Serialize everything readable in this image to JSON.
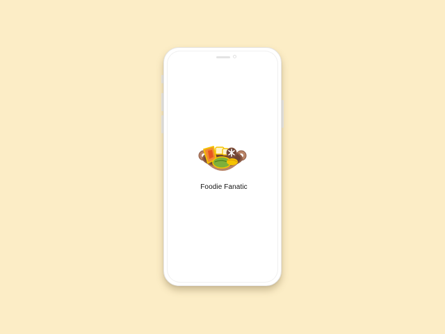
{
  "app": {
    "name": "Foodie Fanatic",
    "logo_icon": "hot-pot-icon"
  },
  "colors": {
    "background": "#fcedc6",
    "phone_body": "#ffffff",
    "pot": "#b98467",
    "pot_rim": "#8c5a44",
    "broth": "#6e4434",
    "carrot": "#f08b32",
    "carrot_outline": "#f5c300",
    "greens": "#7fb03a",
    "tofu": "#fff5cc",
    "mushroom": "#ffffff",
    "app_name_text": "#111111"
  }
}
